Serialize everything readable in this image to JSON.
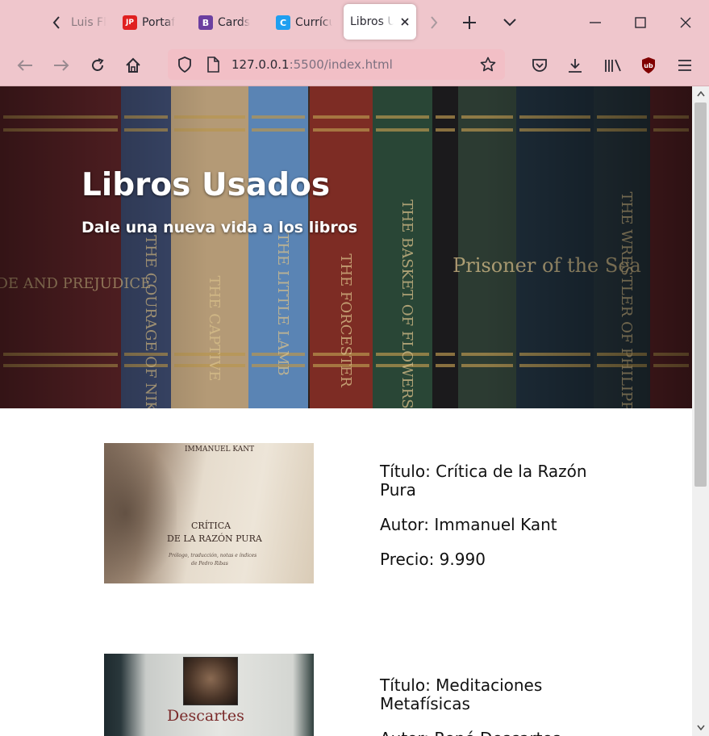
{
  "browser": {
    "tabs": [
      {
        "label": "Luis Fl",
        "favicon": "",
        "active": false
      },
      {
        "label": "Portaf",
        "favicon": "JP",
        "active": false
      },
      {
        "label": "Cards",
        "favicon": "B",
        "active": false
      },
      {
        "label": "Currícu",
        "favicon": "C",
        "active": false
      },
      {
        "label": "Libros U",
        "favicon": "",
        "active": true
      }
    ],
    "url": {
      "host": "127.0.0.1",
      "rest": ":5500/index.html"
    }
  },
  "hero": {
    "title": "Libros Usados",
    "subtitle": "Dale una nueva vida a los libros"
  },
  "books": [
    {
      "titulo": "Título: Crítica de la Razón Pura",
      "autor": "Autor: Immanuel Kant",
      "precio": "Precio: 9.990",
      "cover_author": "IMMANUEL KANT",
      "cover_title_1": "CRÍTICA",
      "cover_title_2": "DE LA RAZÓN PURA",
      "cover_note_1": "Prólogo, traducción, notas e índices",
      "cover_note_2": "de Pedro Ribas"
    },
    {
      "titulo": "Título: Meditaciones Metafísicas",
      "autor": "Autor: René Descartes",
      "precio": "",
      "cover_author": "Descartes"
    }
  ],
  "spines": [
    {
      "text": "PRIDE AND PREJUDICE",
      "color": "#6d2b2e"
    },
    {
      "text": "THE COURAGE OF NIKA",
      "color": "#3c4a6d"
    },
    {
      "text": "THE CAPTIVE",
      "color": "#b59a78"
    },
    {
      "text": "THE LITTLE LAMB",
      "color": "#5c86b6"
    },
    {
      "text": "THE FORCESTER",
      "color": "#7a2d25"
    },
    {
      "text": "THE BASKET OF FLOWERS",
      "color": "#2d4a3c"
    },
    {
      "text": "Prisoner of the Sea",
      "color": "#1e2e3a"
    },
    {
      "text": "THE WRESTLER OF PHILIPPI",
      "color": "#26333a"
    }
  ]
}
